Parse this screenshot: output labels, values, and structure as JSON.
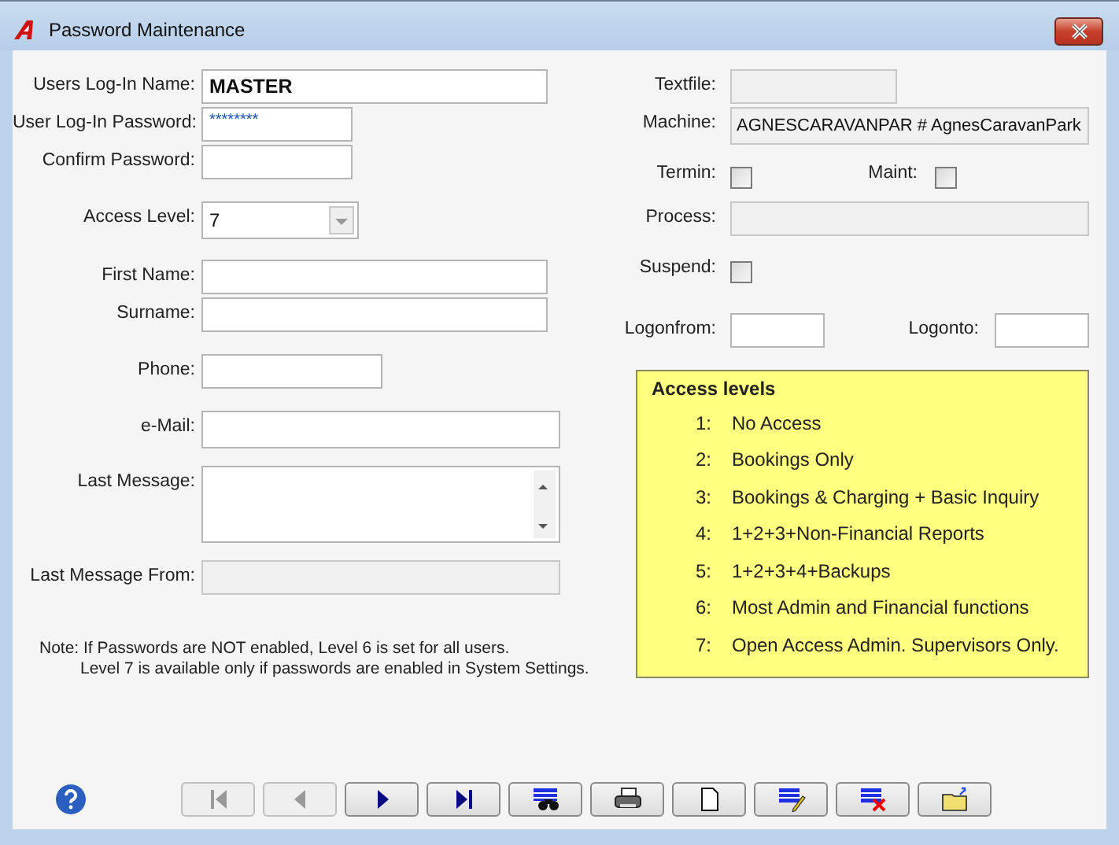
{
  "window": {
    "title": "Password Maintenance"
  },
  "left_fields": [
    {
      "kind": "text",
      "label": "Users Log-In Name:",
      "value": "MASTER",
      "disabled": false
    },
    {
      "kind": "password",
      "label": "User Log-In Password:",
      "value": "********",
      "disabled": false
    },
    {
      "kind": "text",
      "label": "Confirm Password:",
      "disabled": false
    },
    {
      "kind": "select",
      "label": "Access Level:",
      "value": "7",
      "disabled": false
    },
    {
      "kind": "text",
      "label": "First Name:",
      "disabled": false
    },
    {
      "kind": "text",
      "label": "Surname:",
      "disabled": false
    },
    {
      "kind": "text",
      "label": "Phone:",
      "disabled": false
    },
    {
      "kind": "text",
      "label": "e-Mail:",
      "disabled": false
    },
    {
      "kind": "textarea",
      "label": "Last Message:",
      "disabled": false
    },
    {
      "kind": "text",
      "label": "Last Message From:",
      "disabled": true
    }
  ],
  "right_fields": [
    {
      "kind": "text",
      "label": "Textfile:",
      "disabled": true
    },
    {
      "kind": "text",
      "label": "Machine:",
      "value": "AGNESCARAVANPAR # AgnesCaravanPark",
      "disabled": true
    },
    {
      "kind": "checkbox",
      "label": "Termin:",
      "checked": false
    },
    {
      "kind": "checkbox",
      "label": "Maint:",
      "checked": false
    },
    {
      "kind": "text",
      "label": "Process:",
      "disabled": true
    },
    {
      "kind": "checkbox",
      "label": "Suspend:",
      "checked": false
    },
    {
      "kind": "text",
      "label": "Logonfrom:",
      "disabled": false
    },
    {
      "kind": "text",
      "label": "Logonto:",
      "disabled": false
    }
  ],
  "access_levels": {
    "title": "Access levels",
    "items": [
      {
        "number": "1:",
        "text": "No Access"
      },
      {
        "number": "2:",
        "text": "Bookings Only"
      },
      {
        "number": "3:",
        "text": "Bookings & Charging + Basic Inquiry"
      },
      {
        "number": "4:",
        "text": "1+2+3+Non-Financial Reports"
      },
      {
        "number": "5:",
        "text": "1+2+3+4+Backups"
      },
      {
        "number": "6:",
        "text": "Most Admin and Financial functions"
      },
      {
        "number": "7:",
        "text": "Open Access Admin. Supervisors Only."
      }
    ]
  },
  "note": [
    "Note: If Passwords are NOT enabled, Level 6 is set for all users.",
    "Level 7 is available only if passwords are enabled in System Settings."
  ],
  "toolbar": [
    {
      "kind": "first",
      "disabled": true
    },
    {
      "kind": "previous",
      "disabled": true
    },
    {
      "kind": "next",
      "disabled": false
    },
    {
      "kind": "last",
      "disabled": false
    },
    {
      "kind": "find",
      "disabled": false
    },
    {
      "kind": "print",
      "disabled": false
    },
    {
      "kind": "new",
      "disabled": false
    },
    {
      "kind": "edit",
      "disabled": false
    },
    {
      "kind": "delete",
      "disabled": false
    },
    {
      "kind": "open",
      "disabled": false
    }
  ]
}
